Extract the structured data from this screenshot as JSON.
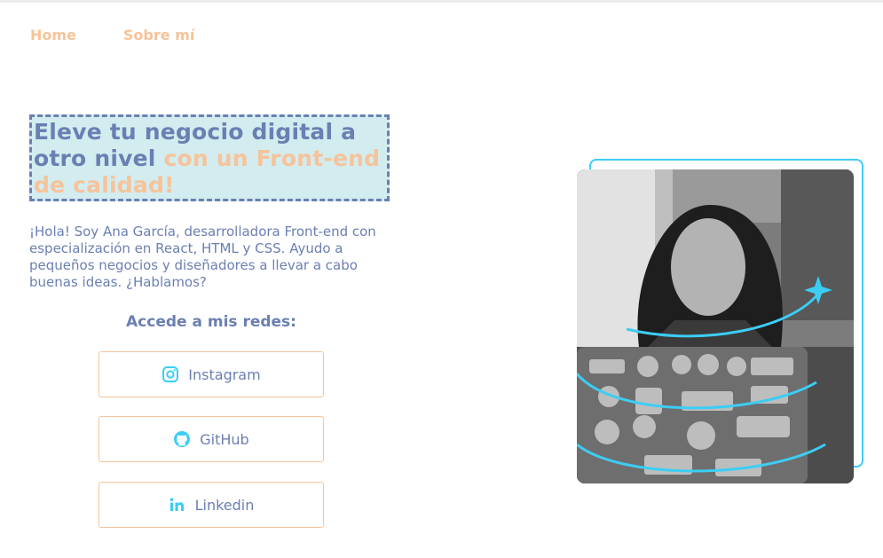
{
  "nav": {
    "home": "Home",
    "about": "Sobre mí"
  },
  "hero": {
    "title_main": "Eleve tu negocio digital a otro nivel",
    "title_accent": "con un Front-end de calidad!",
    "intro": "¡Hola! Soy Ana García, desarrolladora Front-end con especialización en React, HTML y CSS. Ayudo a pequeños negocios y diseñadores a llevar a cabo buenas ideas. ¿Hablamos?"
  },
  "social": {
    "heading": "Accede a mis redes:",
    "buttons": [
      {
        "label": "Instagram",
        "icon": "instagram-icon"
      },
      {
        "label": "GitHub",
        "icon": "github-icon"
      },
      {
        "label": "Linkedin",
        "icon": "linkedin-icon"
      }
    ]
  },
  "colors": {
    "primary": "#6b7fb3",
    "accent": "#f6c39a",
    "highlight_bg": "#d3ecef",
    "cyan": "#3ccdf5"
  }
}
